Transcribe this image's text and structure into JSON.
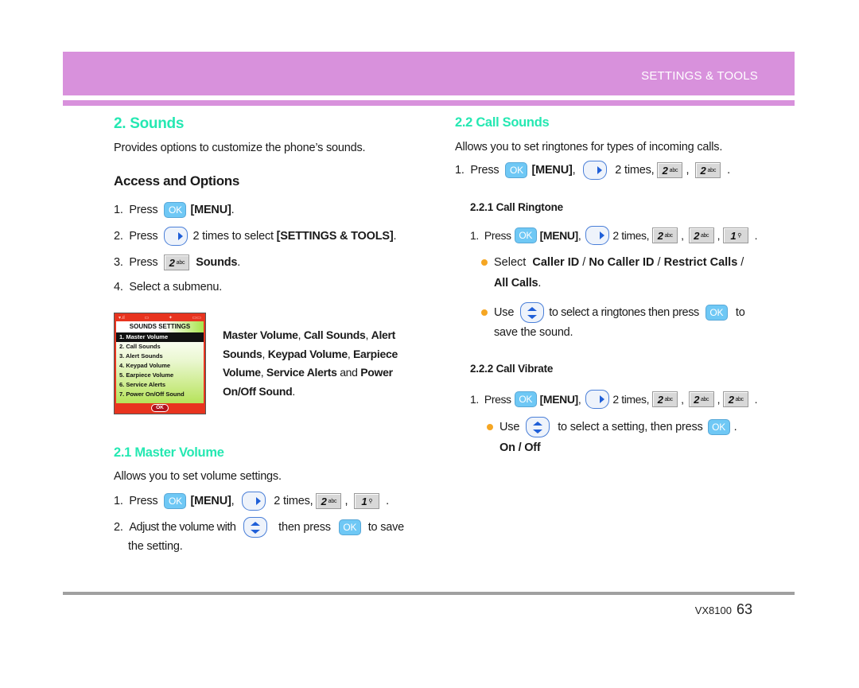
{
  "header": {
    "section_title": "SETTINGS & TOOLS",
    "band_color": "#d891dc"
  },
  "left": {
    "title": "2. Sounds",
    "intro": "Provides options to customize the phone’s sounds.",
    "access_heading": "Access and Options",
    "steps": [
      {
        "num": "1.",
        "pre": "Press",
        "key": "OK",
        "bold": "[MENU]",
        "post": "."
      },
      {
        "num": "2.",
        "pre": "Press",
        "post": "2 times to select",
        "bold": "[SETTINGS & TOOLS]",
        "end": "."
      },
      {
        "num": "3.",
        "pre": "Press",
        "key_num": "2",
        "key_sub": "abc",
        "bold": "Sounds",
        "end": "."
      },
      {
        "num": "4.",
        "text": "Select a submenu."
      }
    ],
    "phone_screen": {
      "title": "SOUNDS SETTINGS",
      "items": [
        "1. Master Volume",
        "2. Call Sounds",
        "3. Alert Sounds",
        "4. Keypad Volume",
        "5. Earpiece Volume",
        "6. Service Alerts",
        "7. Power On/Off Sound"
      ],
      "selected_index": 0,
      "soft_key": "OK"
    },
    "submenu_desc": {
      "bold1": "Master Volume",
      "sep1": ", ",
      "bold2": "Call Sounds",
      "sep2": ", ",
      "bold3": "Alert Sounds",
      "sep3": ", ",
      "bold4": "Keypad Volume",
      "sep4": ", ",
      "bold5": "Earpiece Volume",
      "sep5": ", ",
      "bold6": "Service Alerts",
      "and": " and ",
      "bold7": "Power On/Off Sound",
      "end": "."
    },
    "master_volume": {
      "title": "2.1 Master Volume",
      "intro": "Allows you to set volume settings.",
      "step1": {
        "num": "1.",
        "pre": "Press",
        "key": "OK",
        "bold": "[MENU]",
        "comma": ",",
        "times": "2 times,",
        "k1": "2",
        "k1s": "abc",
        "k2": "1",
        "sep": ",",
        "end": "."
      },
      "step2": {
        "num": "2.",
        "pre": "Adjust the volume with",
        "mid": "then press",
        "key": "OK",
        "post": "to save",
        "cont": "the setting."
      }
    }
  },
  "right": {
    "title": "2.2 Call Sounds",
    "intro": "Allows you to set ringtones for types of incoming calls.",
    "step1": {
      "num": "1.",
      "pre": "Press",
      "key": "OK",
      "bold": "[MENU]",
      "comma": ",",
      "times": "2 times,",
      "k1": "2",
      "k2": "2",
      "sep": ",",
      "end": "."
    },
    "ringtone": {
      "title": "2.2.1 Call Ringtone",
      "step1": {
        "num": "1.",
        "pre": "Press",
        "key": "OK",
        "bold": "[MENU]",
        "comma": ",",
        "times": "2 times,",
        "k1": "2",
        "k2": "2",
        "k3": "1",
        "sep": ",",
        "end": "."
      },
      "bullet1": {
        "pre": "Select",
        "b1": "Caller ID",
        "s": " / ",
        "b2": "No Caller ID",
        "b3": "Restrict Calls",
        "tail": " /",
        "b4": "All Calls",
        "end": "."
      },
      "bullet2": {
        "pre": "Use",
        "mid": "to select a ringtones then press",
        "key": "OK",
        "post": "to",
        "cont": "save the sound."
      }
    },
    "vibrate": {
      "title": "2.2.2 Call Vibrate",
      "step1": {
        "num": "1.",
        "pre": "Press",
        "key": "OK",
        "bold": "[MENU]",
        "comma": ",",
        "times": "2 times,",
        "k1": "2",
        "k2": "2",
        "k3": "2",
        "sep": ",",
        "end": "."
      },
      "bullet1": {
        "pre": "Use",
        "mid": "to select a setting, then press",
        "key": "OK",
        "end": ".",
        "options": "On / Off"
      }
    }
  },
  "footer": {
    "model": "VX8100",
    "page": "63"
  },
  "colors": {
    "heading_green": "#25e8b2",
    "bullet_orange": "#f5a623",
    "ok_key_blue": "#6fc8f5"
  }
}
